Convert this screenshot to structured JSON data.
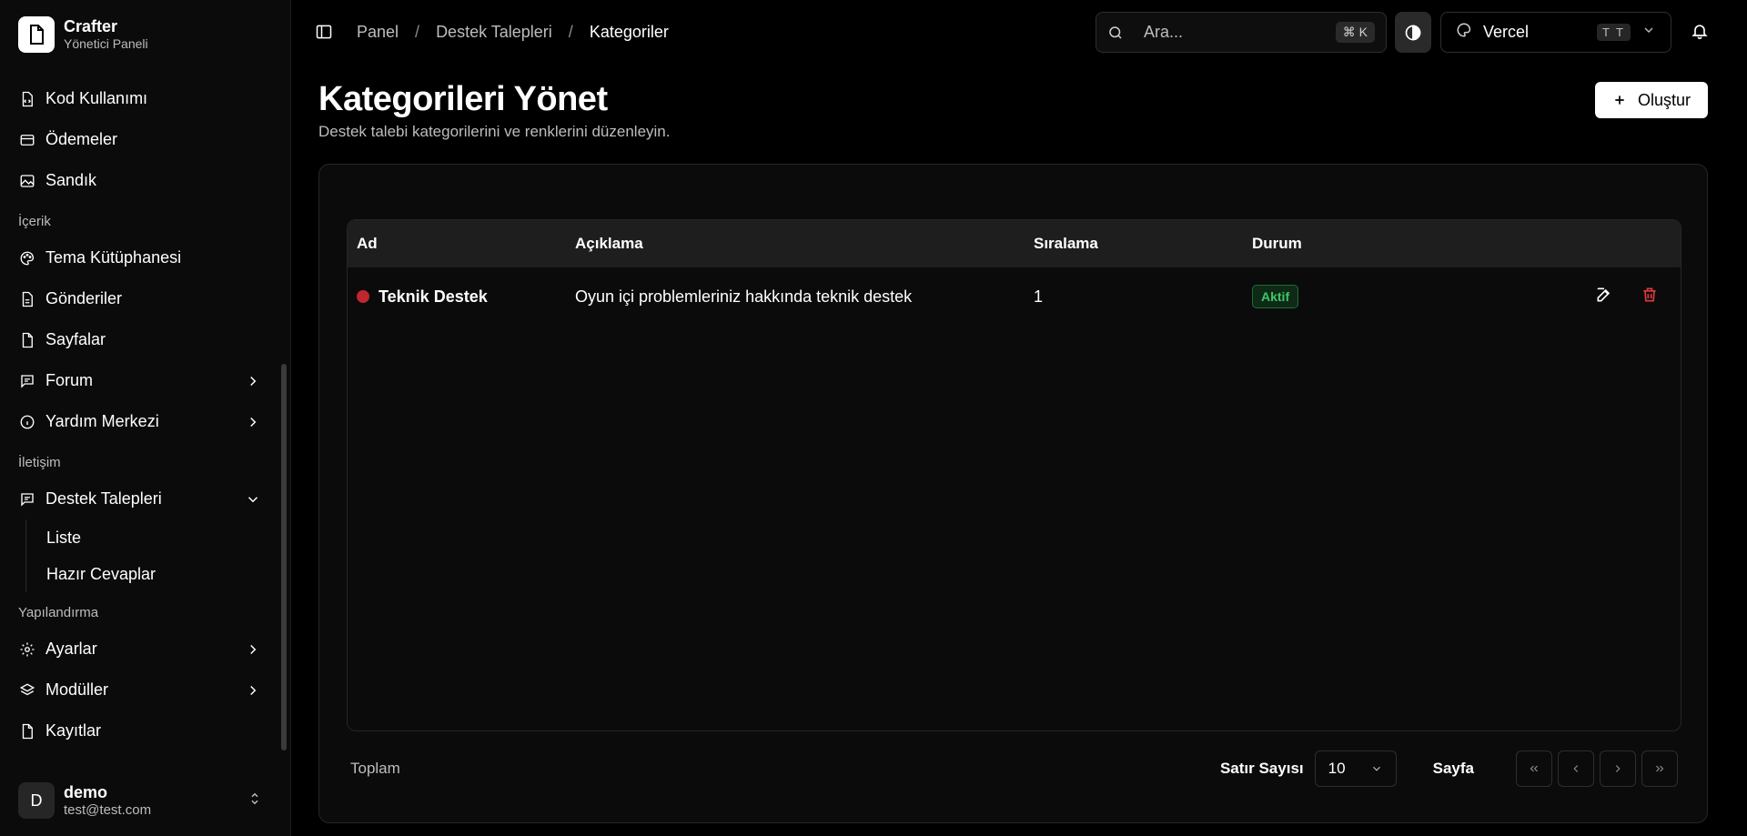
{
  "brand": {
    "title": "Crafter",
    "subtitle": "Yönetici Paneli"
  },
  "sidebar": {
    "top_items": [
      {
        "label": "Kod Kullanımı",
        "icon": "file-code-icon"
      },
      {
        "label": "Ödemeler",
        "icon": "credit-card-icon"
      },
      {
        "label": "Sandık",
        "icon": "image-icon"
      }
    ],
    "groups": [
      {
        "label": "İçerik",
        "items": [
          {
            "label": "Tema Kütüphanesi",
            "icon": "palette-icon"
          },
          {
            "label": "Gönderiler",
            "icon": "file-icon"
          },
          {
            "label": "Sayfalar",
            "icon": "file-icon"
          },
          {
            "label": "Forum",
            "icon": "message-icon",
            "chevron": "right"
          },
          {
            "label": "Yardım Merkezi",
            "icon": "info-icon",
            "chevron": "right"
          }
        ]
      },
      {
        "label": "İletişim",
        "items": [
          {
            "label": "Destek Talepleri",
            "icon": "message-icon",
            "chevron": "down",
            "sub": [
              "Liste",
              "Hazır Cevaplar"
            ]
          }
        ]
      },
      {
        "label": "Yapılandırma",
        "items": [
          {
            "label": "Ayarlar",
            "icon": "gear-icon",
            "chevron": "right"
          },
          {
            "label": "Modüller",
            "icon": "layers-icon",
            "chevron": "right"
          },
          {
            "label": "Kayıtlar",
            "icon": "file-icon"
          }
        ]
      }
    ]
  },
  "user": {
    "initial": "D",
    "name": "demo",
    "email": "test@test.com"
  },
  "breadcrumb": {
    "items": [
      "Panel",
      "Destek Talepleri"
    ],
    "current": "Kategoriler"
  },
  "search": {
    "placeholder": "Ara...",
    "shortcut": "⌘ K"
  },
  "theme_selector": {
    "name": "Vercel",
    "badge": "T T"
  },
  "page": {
    "title": "Kategorileri Yönet",
    "subtitle": "Destek talebi kategorilerini ve renklerini düzenleyin.",
    "create_label": "Oluştur"
  },
  "table": {
    "columns": [
      "Ad",
      "Açıklama",
      "Sıralama",
      "Durum"
    ],
    "rows": [
      {
        "name": "Teknik Destek",
        "color": "#c0262f",
        "description": "Oyun içi problemleriniz hakkında teknik destek",
        "order": "1",
        "status": "Aktif"
      }
    ]
  },
  "pager": {
    "total_label": "Toplam",
    "rows_label": "Satır Sayısı",
    "rows_value": "10",
    "page_label": "Sayfa"
  },
  "colors": {
    "accent_danger": "#e0393f",
    "status_active": "#3fc66a"
  }
}
